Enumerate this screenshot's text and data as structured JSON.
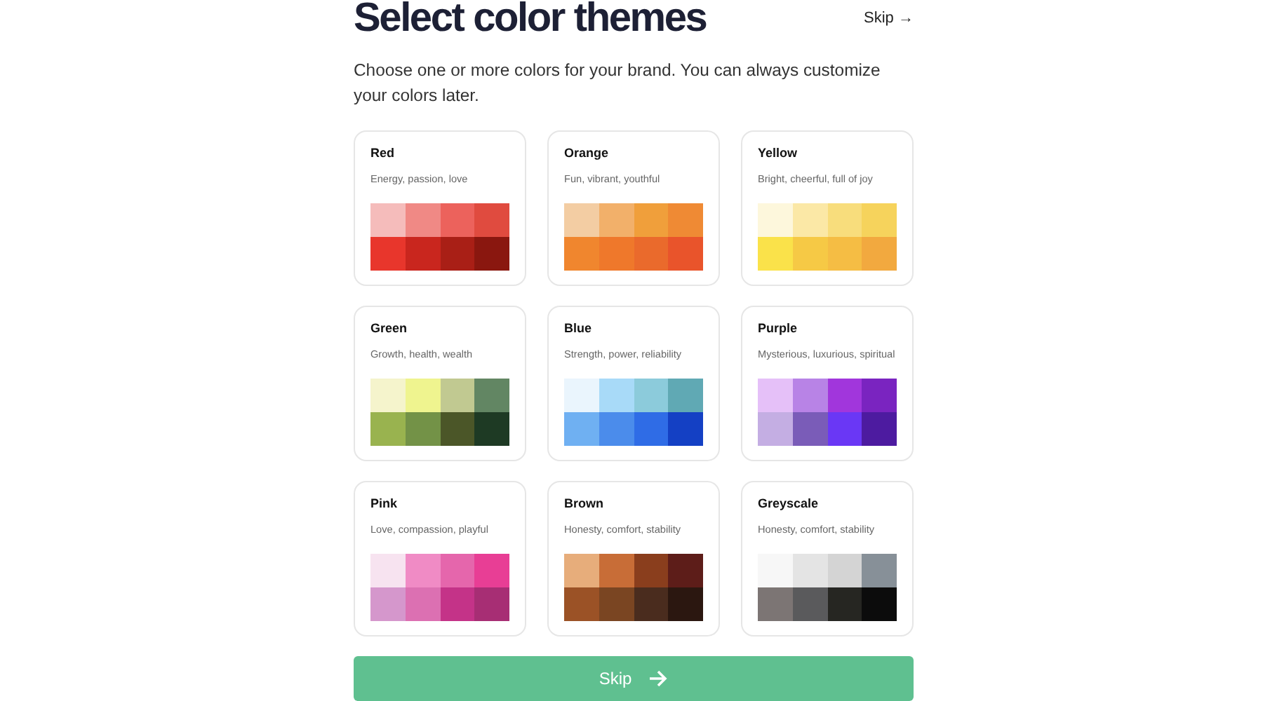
{
  "title": "Select color themes",
  "skip_link": "Skip →",
  "subtitle": "Choose one or more colors for your brand. You can always customize your colors later.",
  "themes": [
    {
      "name": "Red",
      "description": "Energy, passion, love",
      "swatches": [
        {
          "color": "#f5bcbb"
        },
        {
          "color": "#f08985"
        },
        {
          "color": "#ec625c"
        },
        {
          "color": "#e04b3f"
        },
        {
          "color": "#e8362c"
        },
        {
          "color": "#c9261e"
        },
        {
          "color": "#a91f16"
        },
        {
          "color": "#8a170f"
        }
      ]
    },
    {
      "name": "Orange",
      "description": "Fun, vibrant, youthful",
      "swatches": [
        {
          "color": "#f3cda3"
        },
        {
          "color": "#f2b06a"
        },
        {
          "color": "#f09f3b"
        },
        {
          "color": "#ef8a34"
        },
        {
          "color": "#f0862e"
        },
        {
          "color": "#ef782b"
        },
        {
          "color": "#ea6a2c"
        },
        {
          "color": "#e9542b"
        }
      ]
    },
    {
      "name": "Yellow",
      "description": "Bright, cheerful, full of joy",
      "swatches": [
        {
          "color": "#fdf7dc"
        },
        {
          "color": "#fbe8a6"
        },
        {
          "color": "#f8dd7c"
        },
        {
          "color": "#f6d35c"
        },
        {
          "color": "#fae24a"
        },
        {
          "color": "#f6c945"
        },
        {
          "color": "#f5bd44"
        },
        {
          "color": "#f2a93f"
        }
      ]
    },
    {
      "name": "Green",
      "description": "Growth, health, wealth",
      "swatches": [
        {
          "color": "#f5f4cc"
        },
        {
          "color": "#eff48f"
        },
        {
          "color": "#c1c991"
        },
        {
          "color": "#628663"
        },
        {
          "color": "#99b34f"
        },
        {
          "color": "#739247"
        },
        {
          "color": "#4b5628"
        },
        {
          "color": "#1e3a24"
        }
      ]
    },
    {
      "name": "Blue",
      "description": "Strength, power, reliability",
      "swatches": [
        {
          "color": "#eaf5fd"
        },
        {
          "color": "#a8daf8"
        },
        {
          "color": "#8ccbdb"
        },
        {
          "color": "#60a9b4"
        },
        {
          "color": "#6fb0f2"
        },
        {
          "color": "#4b8ceb"
        },
        {
          "color": "#2f6ce6"
        },
        {
          "color": "#1440c4"
        }
      ]
    },
    {
      "name": "Purple",
      "description": "Mysterious, luxurious, spiritual",
      "swatches": [
        {
          "color": "#e5c0f8"
        },
        {
          "color": "#b883e6"
        },
        {
          "color": "#a136dc"
        },
        {
          "color": "#7a24c0"
        },
        {
          "color": "#c4aee3"
        },
        {
          "color": "#7a5cb8"
        },
        {
          "color": "#6a37f5"
        },
        {
          "color": "#4d1ba0"
        }
      ]
    },
    {
      "name": "Pink",
      "description": "Love, compassion, playful",
      "swatches": [
        {
          "color": "#f7e3f0"
        },
        {
          "color": "#f08bc5"
        },
        {
          "color": "#e566ac"
        },
        {
          "color": "#e83e95"
        },
        {
          "color": "#d597cc"
        },
        {
          "color": "#dc70b2"
        },
        {
          "color": "#c43388"
        },
        {
          "color": "#a72e74"
        }
      ]
    },
    {
      "name": "Brown",
      "description": "Honesty, comfort, stability",
      "swatches": [
        {
          "color": "#e7ad7b"
        },
        {
          "color": "#c86d37"
        },
        {
          "color": "#8a3e1d"
        },
        {
          "color": "#5d1d19"
        },
        {
          "color": "#9b5226"
        },
        {
          "color": "#7a4522"
        },
        {
          "color": "#4a2c1e"
        },
        {
          "color": "#2b1710"
        }
      ]
    },
    {
      "name": "Greyscale",
      "description": "Honesty, comfort, stability",
      "swatches": [
        {
          "color": "#f7f7f7"
        },
        {
          "color": "#e4e4e4"
        },
        {
          "color": "#d4d4d4"
        },
        {
          "color": "#879098"
        },
        {
          "color": "#7c7574"
        },
        {
          "color": "#5a5a5c"
        },
        {
          "color": "#262622"
        },
        {
          "color": "#0c0c0c"
        }
      ]
    }
  ],
  "button": "Skip"
}
